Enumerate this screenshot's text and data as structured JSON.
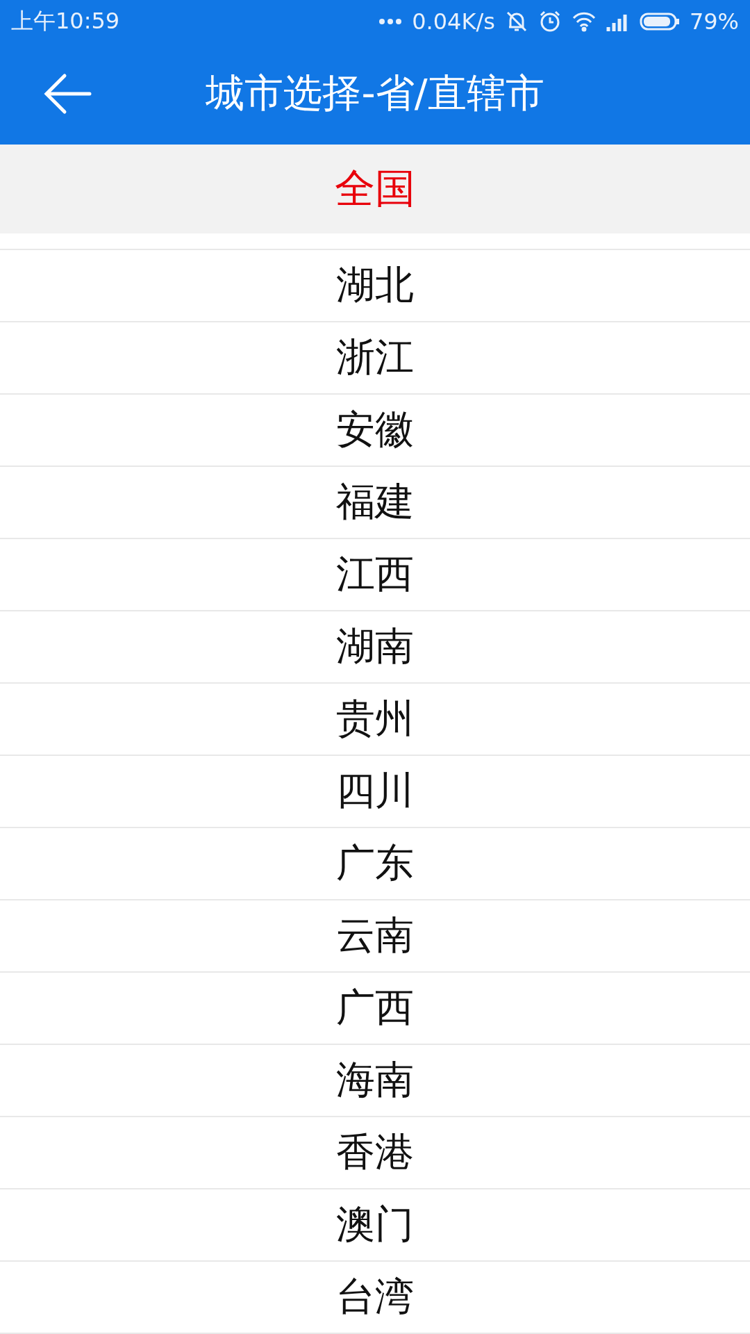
{
  "status_bar": {
    "time": "上午10:59",
    "speed": "0.04K/s",
    "battery": "79%"
  },
  "app_bar": {
    "title": "城市选择-省/直辖市"
  },
  "header": {
    "label": "全国"
  },
  "provinces": [
    "湖北",
    "浙江",
    "安徽",
    "福建",
    "江西",
    "湖南",
    "贵州",
    "四川",
    "广东",
    "云南",
    "广西",
    "海南",
    "香港",
    "澳门",
    "台湾"
  ]
}
